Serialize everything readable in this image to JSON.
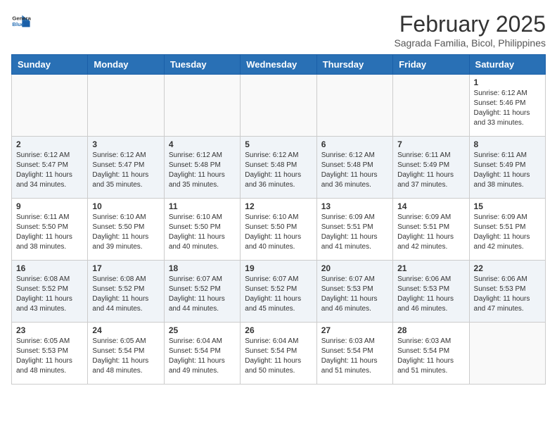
{
  "header": {
    "logo_general": "General",
    "logo_blue": "Blue",
    "month_year": "February 2025",
    "location": "Sagrada Familia, Bicol, Philippines"
  },
  "days_of_week": [
    "Sunday",
    "Monday",
    "Tuesday",
    "Wednesday",
    "Thursday",
    "Friday",
    "Saturday"
  ],
  "weeks": [
    [
      {
        "day": "",
        "info": ""
      },
      {
        "day": "",
        "info": ""
      },
      {
        "day": "",
        "info": ""
      },
      {
        "day": "",
        "info": ""
      },
      {
        "day": "",
        "info": ""
      },
      {
        "day": "",
        "info": ""
      },
      {
        "day": "1",
        "info": "Sunrise: 6:12 AM\nSunset: 5:46 PM\nDaylight: 11 hours\nand 33 minutes."
      }
    ],
    [
      {
        "day": "2",
        "info": "Sunrise: 6:12 AM\nSunset: 5:47 PM\nDaylight: 11 hours\nand 34 minutes."
      },
      {
        "day": "3",
        "info": "Sunrise: 6:12 AM\nSunset: 5:47 PM\nDaylight: 11 hours\nand 35 minutes."
      },
      {
        "day": "4",
        "info": "Sunrise: 6:12 AM\nSunset: 5:48 PM\nDaylight: 11 hours\nand 35 minutes."
      },
      {
        "day": "5",
        "info": "Sunrise: 6:12 AM\nSunset: 5:48 PM\nDaylight: 11 hours\nand 36 minutes."
      },
      {
        "day": "6",
        "info": "Sunrise: 6:12 AM\nSunset: 5:48 PM\nDaylight: 11 hours\nand 36 minutes."
      },
      {
        "day": "7",
        "info": "Sunrise: 6:11 AM\nSunset: 5:49 PM\nDaylight: 11 hours\nand 37 minutes."
      },
      {
        "day": "8",
        "info": "Sunrise: 6:11 AM\nSunset: 5:49 PM\nDaylight: 11 hours\nand 38 minutes."
      }
    ],
    [
      {
        "day": "9",
        "info": "Sunrise: 6:11 AM\nSunset: 5:50 PM\nDaylight: 11 hours\nand 38 minutes."
      },
      {
        "day": "10",
        "info": "Sunrise: 6:10 AM\nSunset: 5:50 PM\nDaylight: 11 hours\nand 39 minutes."
      },
      {
        "day": "11",
        "info": "Sunrise: 6:10 AM\nSunset: 5:50 PM\nDaylight: 11 hours\nand 40 minutes."
      },
      {
        "day": "12",
        "info": "Sunrise: 6:10 AM\nSunset: 5:50 PM\nDaylight: 11 hours\nand 40 minutes."
      },
      {
        "day": "13",
        "info": "Sunrise: 6:09 AM\nSunset: 5:51 PM\nDaylight: 11 hours\nand 41 minutes."
      },
      {
        "day": "14",
        "info": "Sunrise: 6:09 AM\nSunset: 5:51 PM\nDaylight: 11 hours\nand 42 minutes."
      },
      {
        "day": "15",
        "info": "Sunrise: 6:09 AM\nSunset: 5:51 PM\nDaylight: 11 hours\nand 42 minutes."
      }
    ],
    [
      {
        "day": "16",
        "info": "Sunrise: 6:08 AM\nSunset: 5:52 PM\nDaylight: 11 hours\nand 43 minutes."
      },
      {
        "day": "17",
        "info": "Sunrise: 6:08 AM\nSunset: 5:52 PM\nDaylight: 11 hours\nand 44 minutes."
      },
      {
        "day": "18",
        "info": "Sunrise: 6:07 AM\nSunset: 5:52 PM\nDaylight: 11 hours\nand 44 minutes."
      },
      {
        "day": "19",
        "info": "Sunrise: 6:07 AM\nSunset: 5:52 PM\nDaylight: 11 hours\nand 45 minutes."
      },
      {
        "day": "20",
        "info": "Sunrise: 6:07 AM\nSunset: 5:53 PM\nDaylight: 11 hours\nand 46 minutes."
      },
      {
        "day": "21",
        "info": "Sunrise: 6:06 AM\nSunset: 5:53 PM\nDaylight: 11 hours\nand 46 minutes."
      },
      {
        "day": "22",
        "info": "Sunrise: 6:06 AM\nSunset: 5:53 PM\nDaylight: 11 hours\nand 47 minutes."
      }
    ],
    [
      {
        "day": "23",
        "info": "Sunrise: 6:05 AM\nSunset: 5:53 PM\nDaylight: 11 hours\nand 48 minutes."
      },
      {
        "day": "24",
        "info": "Sunrise: 6:05 AM\nSunset: 5:54 PM\nDaylight: 11 hours\nand 48 minutes."
      },
      {
        "day": "25",
        "info": "Sunrise: 6:04 AM\nSunset: 5:54 PM\nDaylight: 11 hours\nand 49 minutes."
      },
      {
        "day": "26",
        "info": "Sunrise: 6:04 AM\nSunset: 5:54 PM\nDaylight: 11 hours\nand 50 minutes."
      },
      {
        "day": "27",
        "info": "Sunrise: 6:03 AM\nSunset: 5:54 PM\nDaylight: 11 hours\nand 51 minutes."
      },
      {
        "day": "28",
        "info": "Sunrise: 6:03 AM\nSunset: 5:54 PM\nDaylight: 11 hours\nand 51 minutes."
      },
      {
        "day": "",
        "info": ""
      }
    ]
  ]
}
